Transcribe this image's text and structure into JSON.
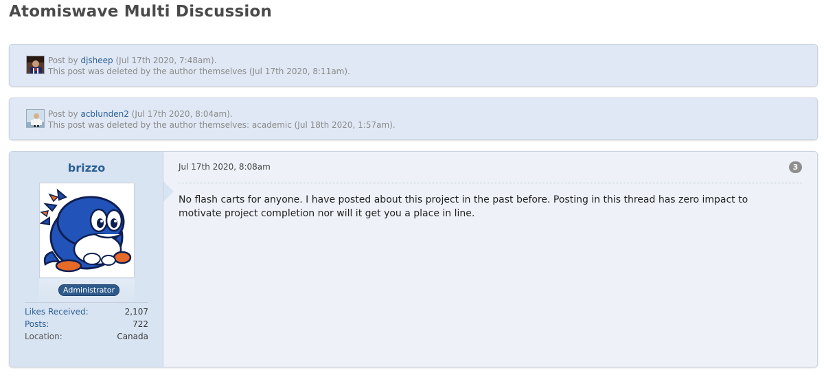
{
  "page": {
    "title": "Atomiswave Multi Discussion"
  },
  "deleted_posts": [
    {
      "prefix": "Post by",
      "author": "djsheep",
      "posted": "(Jul 17th 2020, 7:48am).",
      "notice": "This post was deleted by the author themselves (Jul 17th 2020, 8:11am)."
    },
    {
      "prefix": "Post by",
      "author": "acblunden2",
      "posted": "(Jul 17th 2020, 8:04am).",
      "notice": "This post was deleted by the author themselves: academic (Jul 18th 2020, 1:57am)."
    }
  ],
  "post": {
    "username": "brizzo",
    "role": "Administrator",
    "stats": [
      {
        "label": "Likes Received:",
        "value": "2,107"
      },
      {
        "label": "Posts:",
        "value": "722"
      },
      {
        "label": "Location:",
        "value": "Canada"
      }
    ],
    "date": "Jul 17th 2020, 8:08am",
    "number": "3",
    "message": "No flash carts for anyone. I have posted about this project in the past before. Posting in this thread has zero impact to motivate project completion nor will it get you a place in line."
  },
  "colors": {
    "link": "#2b5d99",
    "userbox": "#d8e4f2",
    "message_bg": "#eef2f8",
    "badge": "#2e5a8a"
  }
}
